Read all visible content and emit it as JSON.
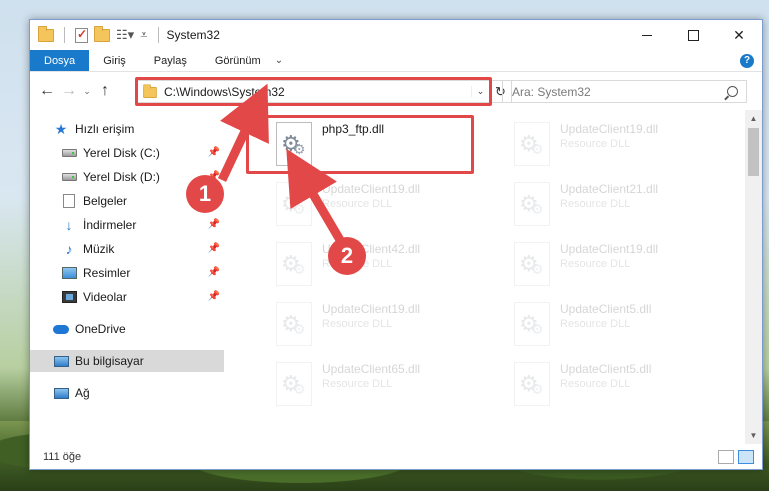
{
  "window": {
    "title": "System32"
  },
  "ribbon": {
    "tabs": [
      "Dosya",
      "Giriş",
      "Paylaş",
      "Görünüm"
    ],
    "help_label": "?",
    "collapse_label": "⌄"
  },
  "titlebar": {
    "minimize_label": "",
    "maximize_label": "",
    "close_label": "✕"
  },
  "navigation": {
    "back_label": "←",
    "forward_label": "→",
    "recent_label": "⌄",
    "up_label": "↑",
    "address": "C:\\Windows\\System32",
    "address_dropdown_label": "⌄",
    "refresh_label": "↻",
    "search_placeholder": "Ara: System32"
  },
  "sidebar": {
    "items": [
      {
        "label": "Hızlı erişim",
        "icon": "star-icon",
        "pinned": false
      },
      {
        "label": "Yerel Disk (C:)",
        "icon": "disk-icon",
        "pinned": true
      },
      {
        "label": "Yerel Disk (D:)",
        "icon": "disk-icon",
        "pinned": true
      },
      {
        "label": "Belgeler",
        "icon": "documents-icon",
        "pinned": true
      },
      {
        "label": "İndirmeler",
        "icon": "download-icon",
        "pinned": true
      },
      {
        "label": "Müzik",
        "icon": "music-icon",
        "pinned": true
      },
      {
        "label": "Resimler",
        "icon": "pictures-icon",
        "pinned": true
      },
      {
        "label": "Videolar",
        "icon": "videos-icon",
        "pinned": true
      },
      {
        "label": "OneDrive",
        "icon": "onedrive-icon",
        "pinned": false
      },
      {
        "label": "Bu bilgisayar",
        "icon": "this-pc-icon",
        "pinned": false,
        "selected": true
      },
      {
        "label": "Ağ",
        "icon": "network-icon",
        "pinned": false
      }
    ],
    "pin_glyph": "📌"
  },
  "files": [
    {
      "name": "php3_ftp.dll",
      "type": "",
      "highlighted": true
    },
    {
      "name": "UpdateClient19.dll",
      "type": "Resource DLL"
    },
    {
      "name": "UpdateClient19.dll",
      "type": "Resource DLL"
    },
    {
      "name": "UpdateClient21.dll",
      "type": "Resource DLL"
    },
    {
      "name": "UpdateClient42.dll",
      "type": "Resource DLL"
    },
    {
      "name": "UpdateClient19.dll",
      "type": "Resource DLL"
    },
    {
      "name": "UpdateClient19.dll",
      "type": "Resource DLL"
    },
    {
      "name": "UpdateClient5.dll",
      "type": "Resource DLL"
    },
    {
      "name": "UpdateClient65.dll",
      "type": "Resource DLL"
    },
    {
      "name": "UpdateClient5.dll",
      "type": "Resource DLL"
    }
  ],
  "statusbar": {
    "item_count": "111 öğe"
  },
  "annotations": {
    "callout_1": "1",
    "callout_2": "2",
    "color": "#e34848"
  },
  "scrollbar": {
    "up_label": "▲",
    "down_label": "▼"
  }
}
